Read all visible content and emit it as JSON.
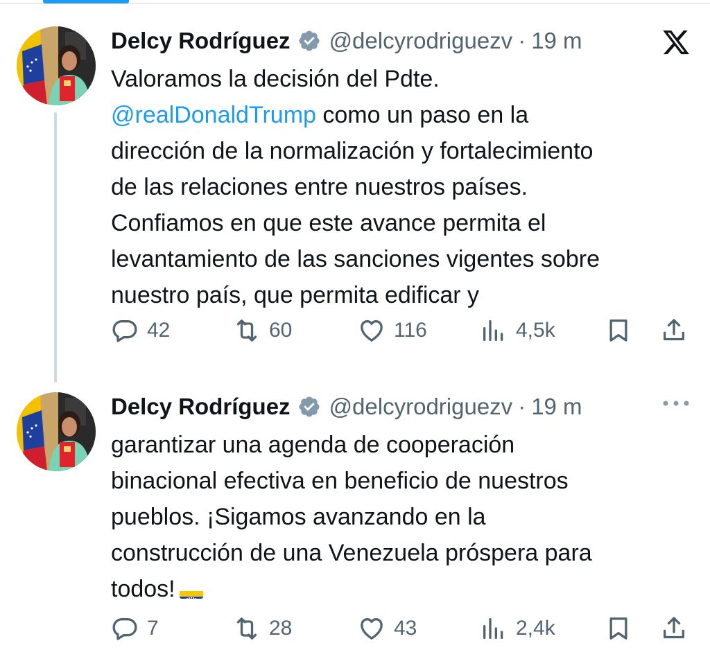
{
  "colors": {
    "accent": "#1d9bf0",
    "secondary_text": "#536471",
    "primary_text": "#0f1419"
  },
  "tweets": [
    {
      "author": "Delcy Rodríguez",
      "handle": "@delcyrodriguezv",
      "separator": "·",
      "time": "19 m",
      "corner_icon": "x-logo-icon",
      "text_lines": [
        "Valoramos la decisión del Pdte.",
        "@realDonaldTrump",
        " como un paso en la",
        "dirección de la normalización y fortalecimiento",
        "de las relaciones entre nuestros países.",
        "Confiamos en que este avance permita el",
        "levantamiento de las sanciones vigentes sobre",
        "nuestro país, que permita edificar y"
      ],
      "stats": {
        "replies": "42",
        "reposts": "60",
        "likes": "116",
        "views": "4,5k"
      }
    },
    {
      "author": "Delcy Rodríguez",
      "handle": "@delcyrodriguezv",
      "separator": "·",
      "time": "19 m",
      "corner_icon": "more-options-icon",
      "text_lines": [
        "garantizar una agenda de cooperación",
        "binacional efectiva en beneficio de nuestros",
        "pueblos. ¡Sigamos avanzando en la",
        "construcción de una Venezuela próspera para",
        "todos!"
      ],
      "emoji": "venezuela-flag-emoji",
      "stats": {
        "replies": "7",
        "reposts": "28",
        "likes": "43",
        "views": "2,4k"
      }
    }
  ]
}
